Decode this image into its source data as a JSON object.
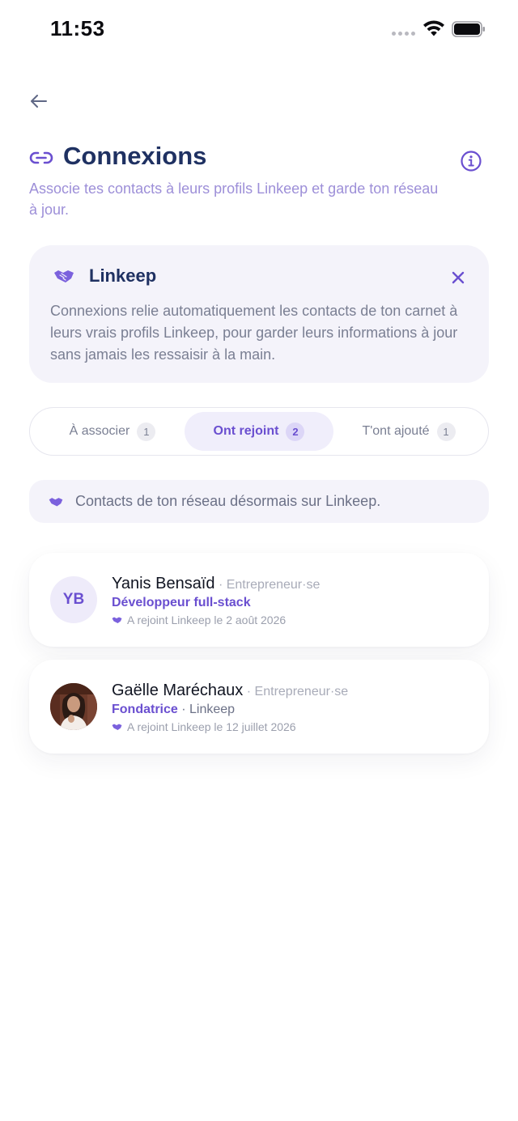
{
  "status_bar": {
    "time": "11:53"
  },
  "header": {
    "title": "Connexions",
    "subtitle": "Associe tes contacts à leurs profils Linkeep et garde ton réseau à jour."
  },
  "info_card": {
    "title": "Linkeep",
    "body": "Connexions relie automatiquement les contacts de ton carnet à leurs vrais profils Linkeep, pour garder leurs informations à jour sans jamais les ressaisir à la main."
  },
  "tabs": [
    {
      "label": "À associer",
      "count": "1",
      "active": false
    },
    {
      "label": "Ont rejoint",
      "count": "2",
      "active": true
    },
    {
      "label": "T'ont ajouté",
      "count": "1",
      "active": false
    }
  ],
  "notice": {
    "text": "Contacts de ton réseau désormais sur Linkeep."
  },
  "contacts": [
    {
      "initials": "YB",
      "name": "Yanis Bensaïd",
      "separator": "·",
      "role": "Entrepreneur·se",
      "position": "Développeur full-stack",
      "company": "",
      "joined": "A rejoint Linkeep le 2 août 2026"
    },
    {
      "initials": "",
      "name": "Gaëlle Maréchaux",
      "separator": "·",
      "role": "Entrepreneur·se",
      "position": "Fondatrice",
      "company": "· Linkeep",
      "joined": "A rejoint Linkeep le 12 juillet 2026"
    }
  ],
  "colors": {
    "accent": "#6a4fd0",
    "title": "#1f3162",
    "subtitle": "#9d8fd8",
    "card_bg": "#f4f3fa"
  },
  "icons": {
    "back": "arrow-left-icon",
    "title": "link-icon",
    "info": "info-circle-icon",
    "card": "handshake-icon",
    "close": "close-icon"
  }
}
